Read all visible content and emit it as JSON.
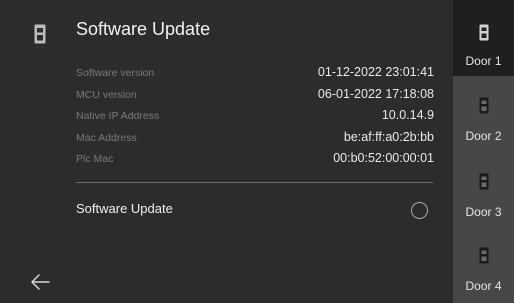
{
  "header": {
    "title": "Software Update"
  },
  "info": [
    {
      "label": "Software version",
      "value": "01-12-2022  23:01:41"
    },
    {
      "label": "MCU version",
      "value": "06-01-2022  17:18:08"
    },
    {
      "label": "Native IP Address",
      "value": "10.0.14.9"
    },
    {
      "label": "Mac Address",
      "value": "be:af:ff:a0:2b:bb"
    },
    {
      "label": "Plc Mac",
      "value": "00:b0:52:00:00:01"
    }
  ],
  "update": {
    "label": "Software Update",
    "selected": false
  },
  "doors": [
    {
      "label": "Door 1",
      "active": true
    },
    {
      "label": "Door 2",
      "active": false
    },
    {
      "label": "Door 3",
      "active": false
    },
    {
      "label": "Door 4",
      "active": false
    }
  ],
  "icons": {
    "device": "door-station-icon",
    "back": "back-arrow-icon",
    "door": "door-station-icon"
  },
  "colors": {
    "background": "#2c2c2c",
    "door_panel": "#474747",
    "door_active": "#1f1f1f",
    "text": "#f2f2f2",
    "label": "#7a7a7a"
  }
}
